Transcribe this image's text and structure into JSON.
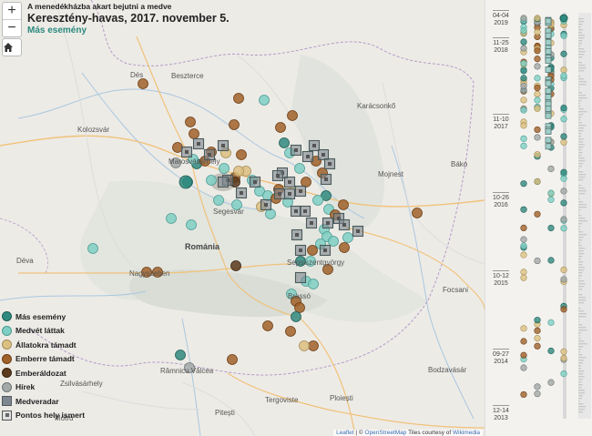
{
  "title": {
    "line1": "A menedékházba akart bejutni a medve",
    "line2": "Keresztény-havas, 2017. november 5.",
    "line3": "Más esemény"
  },
  "controls": {
    "zoom_in": "+",
    "zoom_out": "−"
  },
  "places": [
    "Dés",
    "Beszterce",
    "Kolozsvár",
    "Karácsonkő",
    "Marosvásárhely",
    "Mojnest",
    "Bákó",
    "Segesvár",
    "Románia",
    "Déva",
    "Nagyszeben",
    "Sepsiszentgyörgy",
    "Brassó",
    "Focsani",
    "Zsilvásárhely",
    "Râmnicu Vâlcea",
    "Bodzavásár",
    "Pitești",
    "Ploiești",
    "Tergoviste",
    "Motru"
  ],
  "legend": [
    {
      "label": "Más esemény",
      "color": "#2f8a7f",
      "shape": "circle"
    },
    {
      "label": "Medvét láttak",
      "color": "#7fcfc4",
      "shape": "circle"
    },
    {
      "label": "Állatokra támadt",
      "color": "#dcc081",
      "shape": "circle"
    },
    {
      "label": "Emberre támadt",
      "color": "#a0612a",
      "shape": "circle"
    },
    {
      "label": "Emberáldozat",
      "color": "#5b3a1d",
      "shape": "circle"
    },
    {
      "label": "Hírek",
      "color": "#a3a9a8",
      "shape": "circle"
    },
    {
      "label": "Medveradar",
      "color": "#7e8790",
      "shape": "square"
    },
    {
      "label": "Pontos hely ismert",
      "color": "#9ea4a3",
      "shape": "square-dot"
    }
  ],
  "attribution": {
    "leaflet": "Leaflet",
    "osm": "OpenStreetMap",
    "tiles": "Tiles courtesy of",
    "wiki": "Wikimedia"
  },
  "timeline": {
    "ticks": [
      {
        "date": "04-04",
        "year": "2019"
      },
      {
        "date": "11-25",
        "year": "2018"
      },
      {
        "date": "11-10",
        "year": "2017"
      },
      {
        "date": "10-26",
        "year": "2016"
      },
      {
        "date": "10-12",
        "year": "2015"
      },
      {
        "date": "09-27",
        "year": "2014"
      },
      {
        "date": "12-14",
        "year": "2013"
      }
    ]
  },
  "colors": {
    "mas": "#2f8a7f",
    "medvet": "#7fcfc4",
    "allat": "#dcc081",
    "ember": "#a0612a",
    "aldozat": "#5b3a1d",
    "hirek": "#a3a9a8",
    "radar": "#7e8790"
  }
}
